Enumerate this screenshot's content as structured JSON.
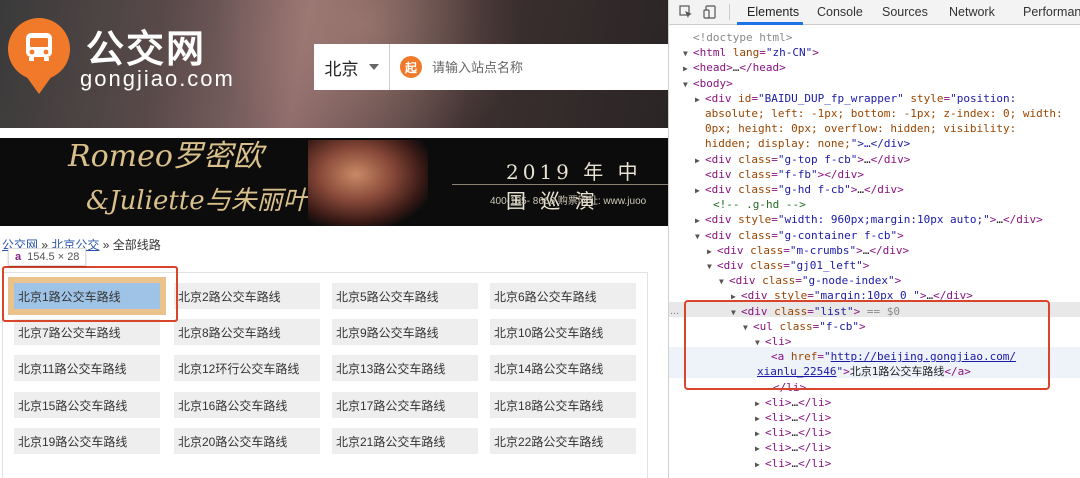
{
  "site": {
    "logo_cn": "公交网",
    "logo_en": "gongjiao.com",
    "city": "北京",
    "search_badge": "起",
    "search_placeholder": "请输入站点名称"
  },
  "banner": {
    "title_line1": "Romeo罗密欧",
    "title_line2": "&Juliette与朱丽叶",
    "year_text": "2019 年 中 国 巡 演",
    "phone_text": "400-185- 8666   购票网址: www.juoo"
  },
  "breadcrumb": {
    "home": "公交网",
    "city": "北京公交",
    "sep": "»",
    "current": "全部线路"
  },
  "tooltip": {
    "tag": "a",
    "size": "154.5 × 28"
  },
  "routes": [
    "北京1路公交车路线",
    "北京2路公交车路线",
    "北京5路公交车路线",
    "北京6路公交车路线",
    "北京7路公交车路线",
    "北京8路公交车路线",
    "北京9路公交车路线",
    "北京10路公交车路线",
    "北京11路公交车路线",
    "北京12环行公交车路线",
    "北京13路公交车路线",
    "北京14路公交车路线",
    "北京15路公交车路线",
    "北京16路公交车路线",
    "北京17路公交车路线",
    "北京18路公交车路线",
    "北京19路公交车路线",
    "北京20路公交车路线",
    "北京21路公交车路线",
    "北京22路公交车路线"
  ],
  "devtools": {
    "tabs": [
      "Elements",
      "Console",
      "Sources",
      "Network",
      "Performan"
    ],
    "active_tab": "Elements",
    "selected_marker": "== $0",
    "ellipsis": "...",
    "lines": [
      "<!doctype html>",
      "<html lang=\"zh-CN\">",
      "<head>…</head>",
      "<body>",
      "<div id=\"BAIDU_DUP_fp_wrapper\" style=\"position:",
      "absolute; left: -1px; bottom: -1px; z-index: 0; width:",
      "0px; height: 0px; overflow: hidden; visibility:",
      "hidden; display: none;\">…</div>",
      "<div class=\"g-top f-cb\">…</div>",
      "<div class=\"f-fb\"></div>",
      "<div class=\"g-hd f-cb\">…</div>",
      "<!-- .g-hd -->",
      "<div style=\"width: 960px;margin:10px auto;\">…</div>",
      "<div class=\"g-container f-cb\">",
      "<div class=\"m-crumbs\">…</div>",
      "<div class=\"gj01_left\">",
      "<div class=\"g-node-index\">",
      "<div style=\"margin:10px 0 \">…</div>",
      "<div class=\"list\">",
      "<ul class=\"f-cb\">",
      "<li>",
      "<a href=\"http://beijing.gongjiao.com/",
      "xianlu_22546\">北京1路公交车路线</a>",
      "</li>",
      "<li>…</li>",
      "<li>…</li>",
      "<li>…</li>",
      "<li>…</li>",
      "<li>…</li>"
    ]
  },
  "colors": {
    "brand_orange": "#f07a2a",
    "highlight_red": "#d9452b",
    "selection_blue": "#9fc3e6",
    "devtools_accent": "#1a73e8"
  }
}
